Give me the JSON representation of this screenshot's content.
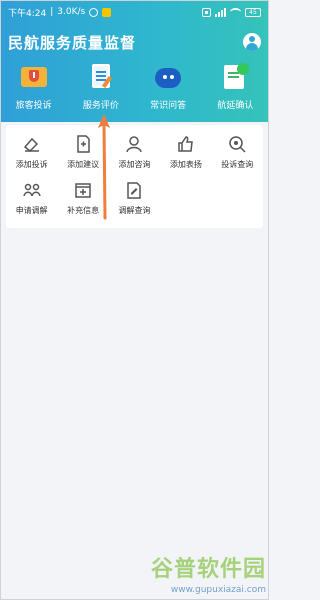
{
  "status_bar": {
    "time": "下午4:24",
    "speed": "3.0K/s",
    "battery": "45"
  },
  "header": {
    "title": "民航服务质量监督"
  },
  "quick_nav": [
    {
      "label": "旅客投诉",
      "icon": "complaint-icon"
    },
    {
      "label": "服务评价",
      "icon": "review-icon"
    },
    {
      "label": "常识问答",
      "icon": "faq-icon"
    },
    {
      "label": "航延确认",
      "icon": "delay-confirm-icon"
    }
  ],
  "services": [
    {
      "label": "添加投诉",
      "icon": "add-complaint-icon"
    },
    {
      "label": "添加建议",
      "icon": "add-suggestion-icon"
    },
    {
      "label": "添加咨询",
      "icon": "add-consultation-icon"
    },
    {
      "label": "添加表扬",
      "icon": "add-praise-icon"
    },
    {
      "label": "投诉查询",
      "icon": "complaint-query-icon"
    },
    {
      "label": "申请调解",
      "icon": "apply-mediation-icon"
    },
    {
      "label": "补充信息",
      "icon": "supplement-info-icon"
    },
    {
      "label": "调解查询",
      "icon": "mediation-query-icon"
    }
  ],
  "watermark": {
    "title": "谷普软件园",
    "url": "www.gupuxiazai.com"
  },
  "colors": {
    "header_start": "#2f9fd7",
    "header_end": "#35c3b9",
    "accent_arrow": "#f07d3c",
    "icon_stroke": "#555555"
  }
}
